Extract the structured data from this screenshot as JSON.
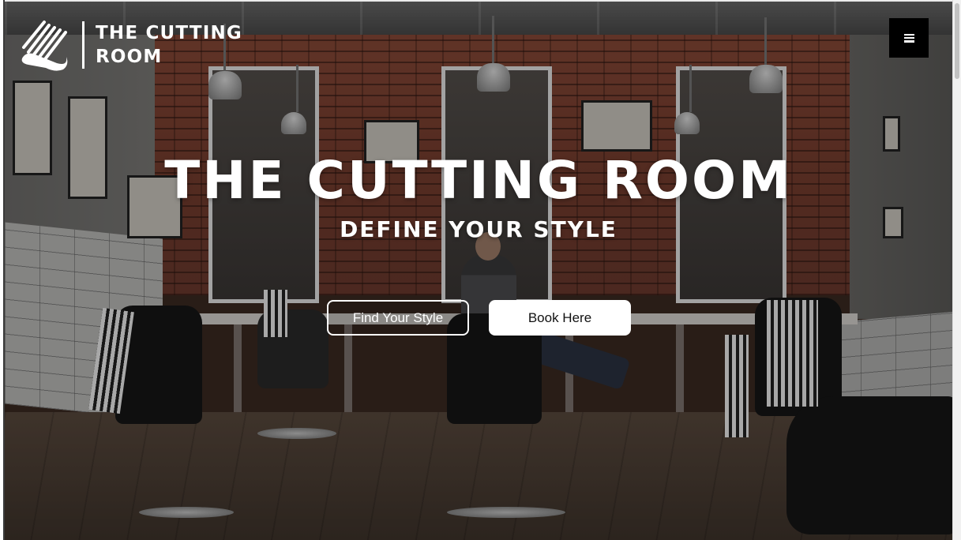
{
  "brand": {
    "line1": "THE CUTTING",
    "line2": "ROOM",
    "icon": "comb-logo-icon"
  },
  "header": {
    "menu_icon": "hamburger-menu-icon"
  },
  "hero": {
    "title": "THE CUTTING ROOM",
    "subtitle": "DEFINE YOUR STYLE",
    "background": "barbershop-interior-photo",
    "buttons": {
      "find_style": "Find Your Style",
      "book": "Book Here"
    }
  },
  "colors": {
    "text": "#ffffff",
    "menu_button": "#000000",
    "book_button_bg": "#ffffff",
    "book_button_text": "#111111"
  }
}
